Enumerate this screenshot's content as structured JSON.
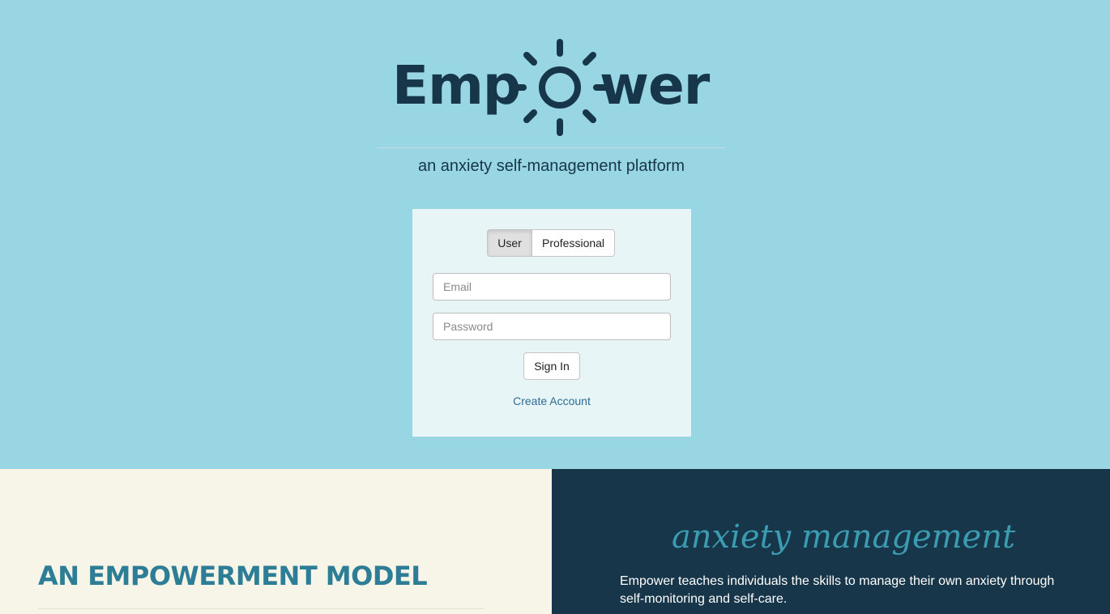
{
  "brand": {
    "logo_left": "Emp",
    "logo_right": "wer",
    "tagline": "an anxiety self-management platform",
    "colors": {
      "navy": "#17364a",
      "sky": "#97d6e2",
      "teal": "#2e7d96",
      "cream": "#f7f4e8"
    }
  },
  "login": {
    "role_toggle": [
      "User",
      "Professional"
    ],
    "selected_role": "User",
    "email_placeholder": "Email",
    "password_placeholder": "Password",
    "signin_label": "Sign In",
    "create_account_label": "Create Account"
  },
  "sections": {
    "model_heading": "AN EMPOWERMENT MODEL",
    "script_heading": "anxiety management",
    "mission_text": "Empower teaches individuals the skills to manage their own anxiety through self-monitoring and self-care."
  },
  "icons": {
    "logo_mark": "sun-icon"
  }
}
